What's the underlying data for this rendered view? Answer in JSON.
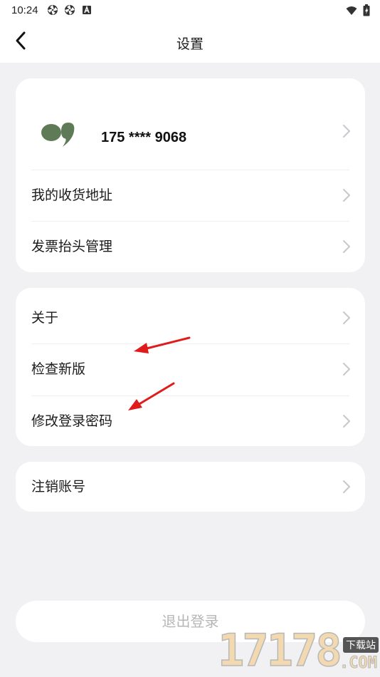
{
  "status_bar": {
    "time": "10:24",
    "left_icons": [
      "aperture-icon",
      "aperture-icon",
      "a-box-icon"
    ],
    "right_icons": [
      "wifi-icon",
      "battery-charging-icon"
    ]
  },
  "header": {
    "title": "设置"
  },
  "account_card": {
    "phone": "175 **** 9068",
    "items": [
      {
        "label": "我的收货地址"
      },
      {
        "label": "发票抬头管理"
      }
    ]
  },
  "info_card": {
    "items": [
      {
        "label": "关于"
      },
      {
        "label": "检查新版"
      },
      {
        "label": "修改登录密码"
      }
    ]
  },
  "danger_card": {
    "items": [
      {
        "label": "注销账号"
      }
    ]
  },
  "logout_label": "退出登录",
  "watermark": {
    "digits": "17178",
    "tag": "下载站",
    "domain": ".COM"
  },
  "colors": {
    "background": "#f1f1f4",
    "card": "#ffffff",
    "avatar": "#5f7a57",
    "chevron": "#c7c7cc",
    "annotation_arrow": "#e01b1b",
    "logout_text": "#b6b6b6"
  }
}
